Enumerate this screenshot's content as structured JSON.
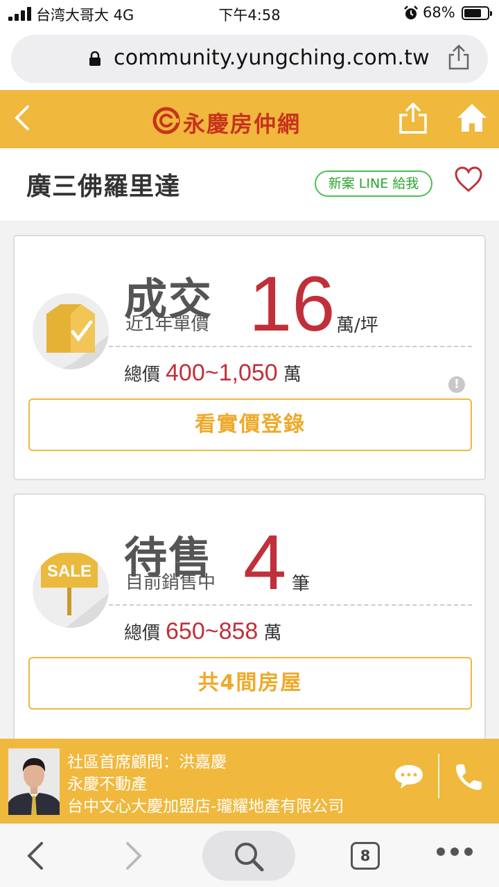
{
  "status_bar": {
    "carrier": "台湾大哥大 4G",
    "time": "下午4:58",
    "battery": "68%"
  },
  "browser": {
    "url": "community.yungching.com.tw",
    "open_tabs": "8"
  },
  "app_header": {
    "logo_text": "永慶房仲網",
    "icons": [
      "back-chevron-icon",
      "share-icon",
      "home-icon"
    ]
  },
  "community": {
    "name": "廣三佛羅里達",
    "line_button": "新案 LINE 給我"
  },
  "sold_card": {
    "label": "成交",
    "sublabel": "近1年單價",
    "value": "16",
    "unit": "萬/坪",
    "total_prefix": "總價",
    "total_range": "400~1,050",
    "total_unit": "萬",
    "info_glyph": "!",
    "button": "看實價登錄"
  },
  "sale_card": {
    "label": "待售",
    "sublabel": "目前銷售中",
    "value": "4",
    "unit": "筆",
    "total_prefix": "總價",
    "total_range": "650~858",
    "total_unit": "萬",
    "sign_text": "SALE",
    "button": "共4間房屋"
  },
  "agent": {
    "title_line": "社區首席顧問：洪嘉慶",
    "company": "永慶不動產",
    "branch": "台中文心大慶加盟店-瓏耀地產有限公司"
  },
  "colors": {
    "brand_yellow": "#f0b83c",
    "price_red": "#c0303a",
    "line_green": "#4cbf4f",
    "logo_red": "#c8321e"
  }
}
